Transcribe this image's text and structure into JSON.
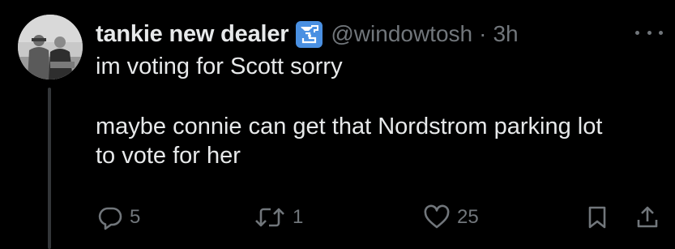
{
  "tweet": {
    "display_name": "tankie new dealer",
    "handle": "@windowtosh",
    "separator": "·",
    "time": "3h",
    "body_lines": [
      "im voting for Scott sorry",
      "maybe connie can get that Nordstrom parking lot",
      "to vote for her"
    ]
  },
  "actions": {
    "reply_count": "5",
    "retweet_count": "1",
    "like_count": "25"
  },
  "icons": {
    "more": "more-horizontal-icon",
    "badge": "affiliate-badge-icon",
    "reply": "reply-bubble-icon",
    "retweet": "retweet-icon",
    "like": "heart-icon",
    "bookmark": "bookmark-icon",
    "share": "share-icon"
  },
  "colors": {
    "background": "#000000",
    "primary_text": "#e7e9ea",
    "secondary_text": "#71767b",
    "badge": "#4a90e2",
    "thread_line": "#333639"
  }
}
